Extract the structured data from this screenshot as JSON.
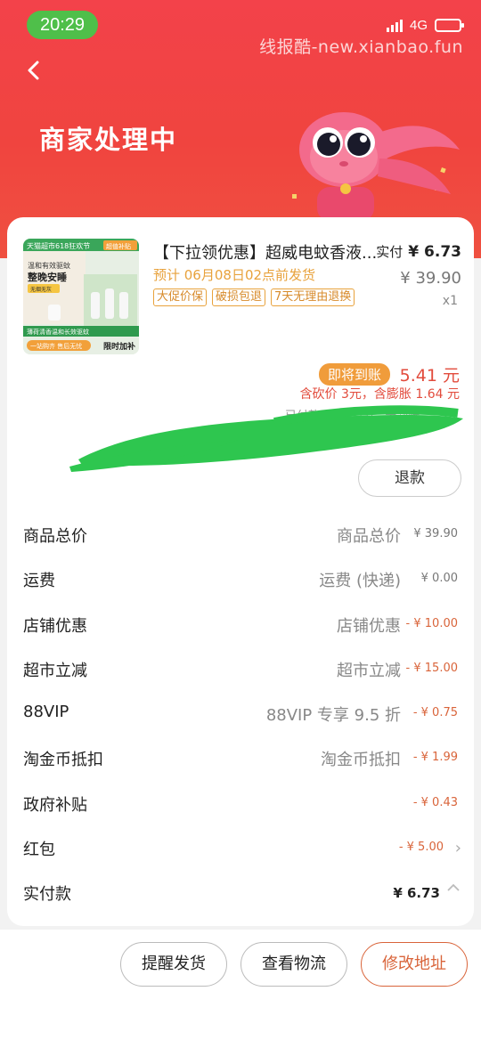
{
  "status_bar": {
    "time": "20:29",
    "network": "4G"
  },
  "watermark": "线报酷-new.xianbao.fun",
  "page_title": "商家处理中",
  "product": {
    "title": "【下拉领优惠】超威电蚊香液...",
    "ship_note": "预计 06月08日02点前发货",
    "tags": [
      "大促价保",
      "破损包退",
      "7天无理由退换"
    ],
    "paid_label": "实付",
    "paid_value": "¥ 6.73",
    "original_price": "¥ 39.90",
    "quantity": "x1",
    "image_texts": {
      "top_banner": "天猫超市618狂欢节",
      "badge": "超值补贴",
      "line1": "温和有效驱蚊",
      "line2": "整晚安睡",
      "line3": "无烟无灰",
      "line4": "薄荷清香温和长效驱蚊",
      "line5": "一站购齐 售后无忧",
      "corner": "限时加补"
    }
  },
  "arrival": {
    "badge": "即将到账",
    "amount": "5.41 元",
    "note": "含砍价 3元，含膨胀 1.64 元",
    "paid_note": "已付款 确认收货后 天到账"
  },
  "refund_label": "退款",
  "price_rows": [
    {
      "label": "商品总价",
      "detail": "商品总价",
      "amount": "¥ 39.90"
    },
    {
      "label": "运费",
      "detail": "运费 (快递)",
      "amount": "¥ 0.00"
    },
    {
      "label": "店铺优惠",
      "detail": "店铺优惠",
      "amount": "- ¥ 10.00"
    },
    {
      "label": "超市立减",
      "detail": "超市立减",
      "amount": "- ¥ 15.00"
    },
    {
      "label": "88VIP",
      "detail": "88VIP 专享 9.5 折",
      "amount": "- ¥ 0.75"
    },
    {
      "label": "淘金币抵扣",
      "detail": "淘金币抵扣",
      "amount": "- ¥ 1.99"
    },
    {
      "label": "政府补贴",
      "detail": "",
      "amount": "- ¥ 0.43"
    },
    {
      "label": "红包",
      "detail": "",
      "amount": "- ¥ 5.00"
    }
  ],
  "total": {
    "label": "实付款",
    "amount": "¥ 6.73"
  },
  "actions": {
    "remind": "提醒发货",
    "logistics": "查看物流",
    "address": "修改地址"
  },
  "colors": {
    "header": "#f0443f",
    "accent_orange": "#e8a23c",
    "discount": "#d9643a",
    "arrival_red": "#e24b3c"
  }
}
